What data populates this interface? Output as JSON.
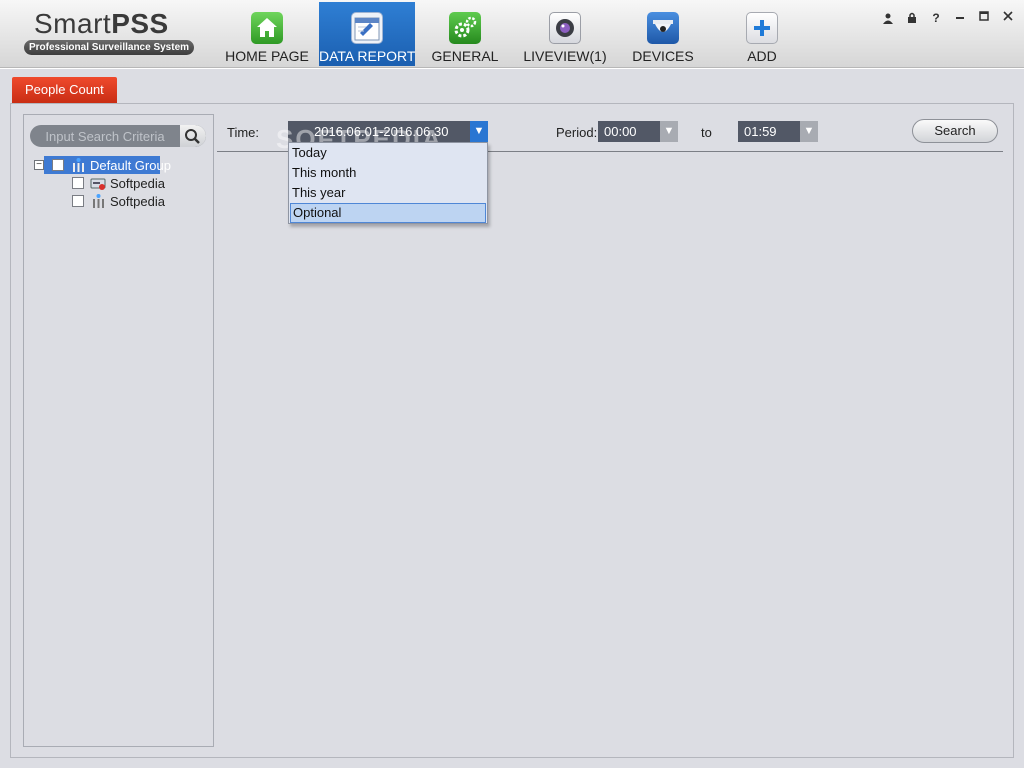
{
  "app": {
    "logo_title_light": "Smart",
    "logo_title_bold": "PSS",
    "logo_subtitle": "Professional Surveillance System"
  },
  "nav": {
    "items": [
      {
        "label": "HOME PAGE",
        "icon": "home-icon",
        "color": "#4caf3b"
      },
      {
        "label": "DATA REPORT",
        "icon": "calendar-report-icon",
        "color": "#e8edf5",
        "active": true
      },
      {
        "label": "GENERAL",
        "icon": "gears-icon",
        "color": "#3fa43a"
      },
      {
        "label": "LIVEVIEW(1)",
        "icon": "camera-lens-icon",
        "color": "#e6e6ea"
      },
      {
        "label": "DEVICES",
        "icon": "dome-camera-icon",
        "color": "#2f6fc2"
      },
      {
        "label": "ADD",
        "icon": "plus-icon",
        "color": "#f4f4f4"
      }
    ]
  },
  "window_controls": {
    "user": "👤",
    "lock": "🔒",
    "help": "?",
    "minimize": "—",
    "maximize": "□",
    "close": "✕"
  },
  "module_tab": {
    "label": "People Count"
  },
  "tree": {
    "search_placeholder": "Input Search Criteria",
    "group_label": "Default Group",
    "devices": [
      {
        "label": "Softpedia",
        "icon": "nvr-device-icon"
      },
      {
        "label": "Softpedia",
        "icon": "people-counter-icon"
      }
    ]
  },
  "filters": {
    "time_label": "Time:",
    "time_value": "2016.06.01-2016.06.30",
    "period_label": "Period:",
    "period_from": "00:00",
    "to_label": "to",
    "period_to": "01:59",
    "search_label": "Search"
  },
  "time_dropdown": {
    "options": [
      "Today",
      "This month",
      "This year",
      "Optional"
    ],
    "highlighted": "Optional"
  },
  "watermark": "SOFTPEDIA",
  "colors": {
    "accent_blue": "#2a76d2",
    "tab_red": "#d93a1e",
    "panel_bg": "#dcdde3"
  }
}
